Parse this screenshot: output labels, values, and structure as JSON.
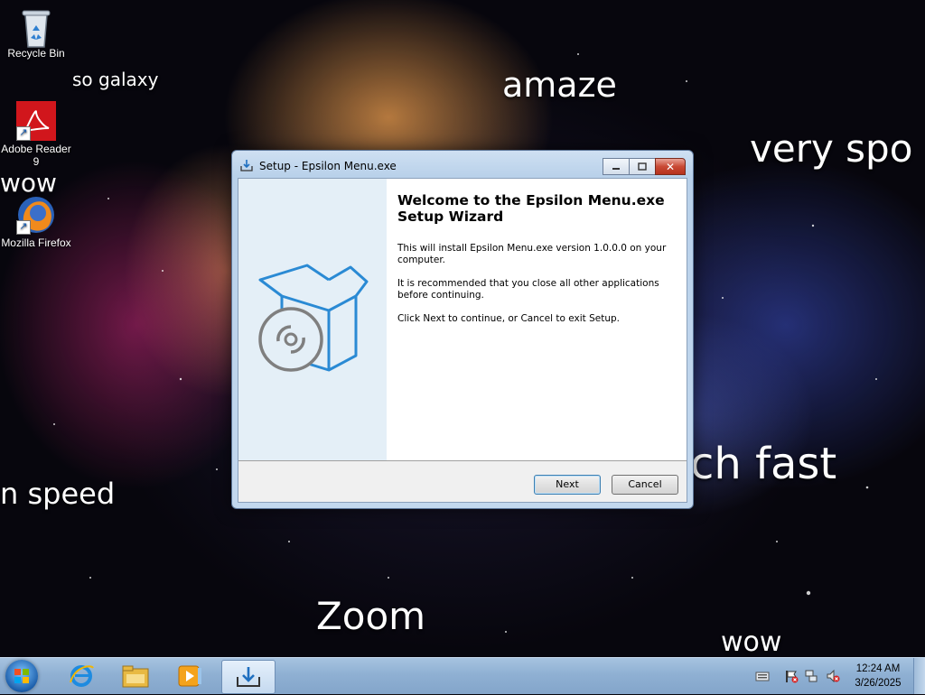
{
  "desktop": {
    "icons": [
      {
        "label": "Recycle Bin",
        "icon": "recycle-bin-icon"
      },
      {
        "label": "Adobe Reader 9",
        "icon": "adobe-reader-icon"
      },
      {
        "label": "Mozilla Firefox",
        "icon": "firefox-icon"
      }
    ],
    "meme_texts": [
      "so galaxy",
      "amaze",
      "very spo",
      "wow",
      "n speed",
      "ch fast",
      "Zoom",
      "wow"
    ]
  },
  "dialog": {
    "title": "Setup - Epsilon Menu.exe",
    "heading": "Welcome to the Epsilon Menu.exe Setup Wizard",
    "paragraphs": [
      "This will install Epsilon Menu.exe version 1.0.0.0 on your computer.",
      "It is recommended that you close all other applications before continuing.",
      "Click Next to continue, or Cancel to exit Setup."
    ],
    "next_label": "Next",
    "cancel_label": "Cancel",
    "minimize_icon": "minimize-icon",
    "maximize_icon": "maximize-icon",
    "close_icon": "close-icon"
  },
  "taskbar": {
    "items": [
      {
        "icon": "start-orb-icon"
      },
      {
        "icon": "internet-explorer-icon"
      },
      {
        "icon": "file-explorer-icon"
      },
      {
        "icon": "media-player-icon"
      },
      {
        "icon": "setup-installer-icon",
        "active": true
      }
    ],
    "tray_icons": [
      "keyboard-icon",
      "action-center-flag-icon",
      "network-icon",
      "volume-muted-icon"
    ],
    "time": "12:24 AM",
    "date": "3/26/2025"
  },
  "colors": {
    "accent": "#2a8ad4",
    "dialog_side": "#e4eff7",
    "taskbar": "#8fb0d3"
  }
}
